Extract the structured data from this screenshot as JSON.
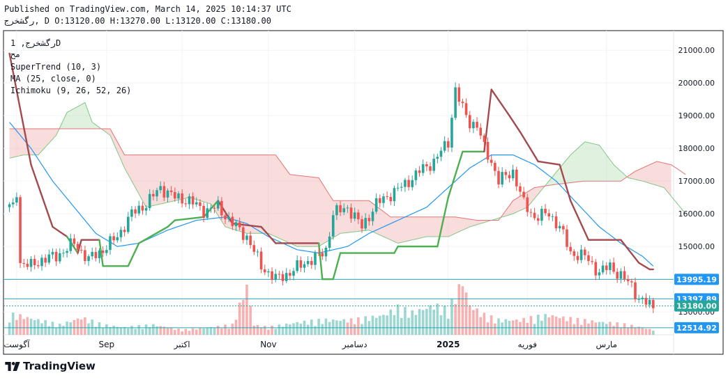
{
  "header": {
    "published": "Published on TradingView.com, March 14, 2025 10:14:37 UTC",
    "ohlc": "رگشخرج, D O:13120.00 H:13270.00 L:13120.00 C:13180.00"
  },
  "legend": {
    "symbol": "رگشخرج, 1D",
    "symbol_sub": "مح",
    "indicators": [
      "SuperTrend (10, 3)",
      "MA (25, close, 0)",
      "Ichimoku (9, 26, 52, 26)"
    ]
  },
  "brand": {
    "name": "TradingView",
    "logo_icon": "tradingview-logo-icon"
  },
  "colors": {
    "up": "#26a69a",
    "down": "#ef5350",
    "supertrend_up": "#4caf50",
    "supertrend_down": "#a44a4f",
    "ma": "#2196f3",
    "kumo_bull": "#a5d6a7",
    "kumo_bear": "#ef9a9a",
    "hline": "#26a5b8",
    "price_label": "#2196f3"
  },
  "chart_data": {
    "type": "candlestick",
    "title": "",
    "ylim": [
      12300,
      21600
    ],
    "y_ticks": [
      13000,
      14000,
      15000,
      16000,
      17000,
      18000,
      19000,
      20000,
      21000
    ],
    "x_labels": [
      "آگوست",
      "Sep",
      "اکتبر",
      "Nov",
      "دسامبر",
      "2025",
      "فوریه",
      "مارس"
    ],
    "x_label_index": [
      2,
      27,
      48,
      72,
      96,
      122,
      144,
      166
    ],
    "n_bars": 180,
    "horizontal_lines": [
      {
        "value": 13995.19,
        "label": "13995.19"
      },
      {
        "value": 13397.89,
        "label": "13397.89"
      },
      {
        "value": 13180.0,
        "label": "13180.00",
        "style": "dotted"
      },
      {
        "value": 12514.92,
        "label": "12514.92"
      }
    ],
    "candle_anchors": [
      [
        1,
        16200
      ],
      [
        2,
        16700
      ],
      [
        3,
        14500
      ],
      [
        6,
        14400
      ],
      [
        9,
        14600
      ],
      [
        13,
        14700
      ],
      [
        18,
        15100
      ],
      [
        22,
        14600
      ],
      [
        26,
        14900
      ],
      [
        30,
        15300
      ],
      [
        34,
        16000
      ],
      [
        38,
        16300
      ],
      [
        42,
        16800
      ],
      [
        46,
        16500
      ],
      [
        50,
        16400
      ],
      [
        54,
        16100
      ],
      [
        58,
        16200
      ],
      [
        62,
        15700
      ],
      [
        66,
        15300
      ],
      [
        70,
        14400
      ],
      [
        74,
        14000
      ],
      [
        78,
        14200
      ],
      [
        82,
        14500
      ],
      [
        86,
        14700
      ],
      [
        88,
        14900
      ],
      [
        90,
        16000
      ],
      [
        94,
        16200
      ],
      [
        98,
        15600
      ],
      [
        102,
        16300
      ],
      [
        106,
        16600
      ],
      [
        110,
        16900
      ],
      [
        114,
        17300
      ],
      [
        118,
        17600
      ],
      [
        120,
        17900
      ],
      [
        122,
        18200
      ],
      [
        124,
        19800
      ],
      [
        126,
        19200
      ],
      [
        128,
        18800
      ],
      [
        130,
        18700
      ],
      [
        132,
        18000
      ],
      [
        134,
        17600
      ],
      [
        136,
        17000
      ],
      [
        140,
        17300
      ],
      [
        143,
        16300
      ],
      [
        146,
        15900
      ],
      [
        150,
        16000
      ],
      [
        153,
        15600
      ],
      [
        156,
        14800
      ],
      [
        160,
        14700
      ],
      [
        164,
        14200
      ],
      [
        167,
        14400
      ],
      [
        170,
        14100
      ],
      [
        173,
        13800
      ],
      [
        175,
        13400
      ],
      [
        178,
        13200
      ],
      [
        179,
        13180
      ]
    ],
    "supertrend": [
      [
        0,
        20900
      ],
      [
        6,
        17500
      ],
      [
        12,
        15600
      ],
      [
        16,
        15300
      ],
      [
        19,
        14800
      ],
      [
        20,
        15200
      ],
      [
        25,
        15200
      ],
      [
        26,
        14400
      ],
      [
        33,
        14400
      ],
      [
        36,
        15100
      ],
      [
        44,
        15600
      ],
      [
        46,
        15800
      ],
      [
        54,
        15900
      ],
      [
        58,
        16400
      ],
      [
        62,
        15700
      ],
      [
        70,
        15600
      ],
      [
        74,
        15100
      ],
      [
        86,
        15100
      ],
      [
        87,
        14000
      ],
      [
        90,
        14000
      ],
      [
        92,
        14800
      ],
      [
        107,
        14800
      ],
      [
        108,
        15000
      ],
      [
        119,
        15000
      ],
      [
        122,
        16500
      ],
      [
        126,
        17900
      ],
      [
        132,
        17900
      ],
      [
        134,
        19800
      ],
      [
        139,
        19000
      ],
      [
        142,
        18500
      ],
      [
        147,
        17600
      ],
      [
        153,
        17500
      ],
      [
        156,
        16400
      ],
      [
        161,
        15200
      ],
      [
        170,
        15200
      ],
      [
        175,
        14500
      ],
      [
        178,
        14300
      ],
      [
        179,
        14300
      ]
    ],
    "ma": [
      [
        0,
        18800
      ],
      [
        6,
        18000
      ],
      [
        12,
        17000
      ],
      [
        18,
        16200
      ],
      [
        24,
        15400
      ],
      [
        30,
        15000
      ],
      [
        36,
        15100
      ],
      [
        44,
        15500
      ],
      [
        52,
        15800
      ],
      [
        60,
        15900
      ],
      [
        66,
        15700
      ],
      [
        72,
        15300
      ],
      [
        80,
        14900
      ],
      [
        86,
        14800
      ],
      [
        94,
        15000
      ],
      [
        100,
        15400
      ],
      [
        108,
        15800
      ],
      [
        116,
        16200
      ],
      [
        122,
        16800
      ],
      [
        128,
        17400
      ],
      [
        134,
        17800
      ],
      [
        140,
        17800
      ],
      [
        146,
        17500
      ],
      [
        152,
        17000
      ],
      [
        158,
        16300
      ],
      [
        164,
        15600
      ],
      [
        170,
        15100
      ],
      [
        176,
        14700
      ],
      [
        179,
        14400
      ]
    ],
    "senkou_a": [
      [
        0,
        17700
      ],
      [
        4,
        17800
      ],
      [
        8,
        17800
      ],
      [
        13,
        18400
      ],
      [
        16,
        19100
      ],
      [
        21,
        19400
      ],
      [
        23,
        18800
      ],
      [
        28,
        18400
      ],
      [
        32,
        17400
      ],
      [
        38,
        16200
      ],
      [
        42,
        16300
      ],
      [
        50,
        16500
      ],
      [
        56,
        16300
      ],
      [
        60,
        15600
      ],
      [
        66,
        15400
      ],
      [
        72,
        15400
      ],
      [
        80,
        15000
      ],
      [
        86,
        15000
      ],
      [
        92,
        15400
      ],
      [
        100,
        15500
      ],
      [
        108,
        15100
      ],
      [
        116,
        15300
      ],
      [
        122,
        15300
      ],
      [
        128,
        15600
      ],
      [
        134,
        15800
      ],
      [
        140,
        16000
      ],
      [
        144,
        16200
      ],
      [
        150,
        17000
      ],
      [
        156,
        17800
      ],
      [
        160,
        18200
      ],
      [
        164,
        18100
      ],
      [
        168,
        17500
      ],
      [
        172,
        17100
      ],
      [
        176,
        17000
      ],
      [
        182,
        16800
      ],
      [
        188,
        16000
      ]
    ],
    "senkou_b": [
      [
        0,
        18600
      ],
      [
        4,
        18600
      ],
      [
        10,
        18600
      ],
      [
        16,
        18600
      ],
      [
        22,
        18600
      ],
      [
        28,
        18600
      ],
      [
        32,
        17800
      ],
      [
        40,
        17800
      ],
      [
        48,
        17800
      ],
      [
        56,
        17800
      ],
      [
        62,
        17800
      ],
      [
        74,
        17800
      ],
      [
        78,
        17200
      ],
      [
        86,
        17100
      ],
      [
        90,
        16400
      ],
      [
        100,
        16400
      ],
      [
        106,
        15900
      ],
      [
        118,
        15900
      ],
      [
        124,
        15900
      ],
      [
        130,
        15800
      ],
      [
        136,
        15800
      ],
      [
        140,
        16400
      ],
      [
        146,
        16800
      ],
      [
        152,
        16900
      ],
      [
        160,
        17000
      ],
      [
        166,
        17000
      ],
      [
        170,
        17000
      ],
      [
        174,
        17300
      ],
      [
        180,
        17600
      ],
      [
        184,
        17500
      ],
      [
        188,
        17200
      ]
    ],
    "volume_anchors": [
      [
        2,
        0.4
      ],
      [
        8,
        0.3
      ],
      [
        14,
        0.2
      ],
      [
        20,
        0.35
      ],
      [
        26,
        0.2
      ],
      [
        32,
        0.15
      ],
      [
        40,
        0.2
      ],
      [
        48,
        0.1
      ],
      [
        56,
        0.15
      ],
      [
        62,
        0.2
      ],
      [
        66,
        1.0
      ],
      [
        68,
        0.2
      ],
      [
        72,
        0.15
      ],
      [
        80,
        0.25
      ],
      [
        88,
        0.3
      ],
      [
        96,
        0.3
      ],
      [
        104,
        0.4
      ],
      [
        108,
        0.55
      ],
      [
        112,
        0.45
      ],
      [
        118,
        0.6
      ],
      [
        122,
        0.5
      ],
      [
        126,
        1.1
      ],
      [
        128,
        0.6
      ],
      [
        132,
        0.4
      ],
      [
        136,
        0.3
      ],
      [
        142,
        0.3
      ],
      [
        150,
        0.4
      ],
      [
        158,
        0.3
      ],
      [
        166,
        0.25
      ],
      [
        172,
        0.2
      ],
      [
        179,
        0.1
      ]
    ]
  }
}
